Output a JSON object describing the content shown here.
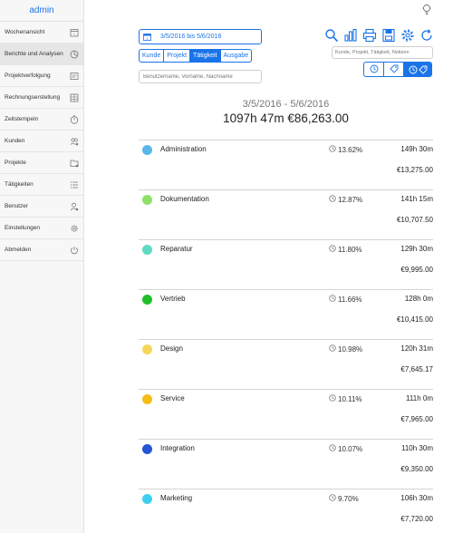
{
  "sidebar": {
    "user": "admin",
    "items": [
      {
        "label": "Wochenansicht",
        "icon": "calendar-icon"
      },
      {
        "label": "Berichte und Analysen",
        "icon": "pie-chart-icon"
      },
      {
        "label": "Projektverfolgung",
        "icon": "tracking-icon"
      },
      {
        "label": "Rechnungserstellung",
        "icon": "invoice-icon"
      },
      {
        "label": "Zeitstempeln",
        "icon": "stopwatch-icon"
      },
      {
        "label": "Kunden",
        "icon": "customers-icon"
      },
      {
        "label": "Projekte",
        "icon": "folder-icon"
      },
      {
        "label": "Tätigkeiten",
        "icon": "list-icon"
      },
      {
        "label": "Benutzer",
        "icon": "user-icon"
      },
      {
        "label": "Einstellungen",
        "icon": "gear-icon"
      },
      {
        "label": "Abmelden",
        "icon": "power-icon"
      }
    ]
  },
  "filters": {
    "date_range": "3/5/2016 bis 5/6/2016",
    "tabs": [
      "Kunde",
      "Projekt",
      "Tätigkeit",
      "Ausgabe"
    ],
    "selected_tab": "Tätigkeit",
    "user_search_placeholder": "Benutzername, Vorname, Nachname",
    "filter_search_placeholder": "Kunde, Projekt, Tätigkeit, Notizen"
  },
  "toolbar": [
    "search-icon",
    "bar-chart-icon",
    "print-icon",
    "save-icon",
    "gear-icon",
    "refresh-icon"
  ],
  "summary": {
    "range": "3/5/2016 - 5/6/2016",
    "total": "1097h 47m   €86,263.00"
  },
  "colors": {
    "accent": "#1a73e8"
  },
  "rows": [
    {
      "name": "Administration",
      "color": "#5ab8e6",
      "percent": "13.62%",
      "hours": "149h 30m",
      "amount": "€13,275.00"
    },
    {
      "name": "Dokumentation",
      "color": "#8ee06a",
      "percent": "12.87%",
      "hours": "141h 15m",
      "amount": "€10,707.50"
    },
    {
      "name": "Reparatur",
      "color": "#5ed9c3",
      "percent": "11.80%",
      "hours": "129h 30m",
      "amount": "€9,995.00"
    },
    {
      "name": "Vertrieb",
      "color": "#20bf2a",
      "percent": "11.66%",
      "hours": "128h 0m",
      "amount": "€10,415.00"
    },
    {
      "name": "Design",
      "color": "#f6d65a",
      "percent": "10.98%",
      "hours": "120h 31m",
      "amount": "€7,645.17"
    },
    {
      "name": "Service",
      "color": "#f6bd16",
      "percent": "10.11%",
      "hours": "111h 0m",
      "amount": "€7,965.00"
    },
    {
      "name": "Integration",
      "color": "#2456d6",
      "percent": "10.07%",
      "hours": "110h 30m",
      "amount": "€9,350.00"
    },
    {
      "name": "Marketing",
      "color": "#3dd0ee",
      "percent": "9.70%",
      "hours": "106h 30m",
      "amount": "€7,720.00"
    }
  ]
}
